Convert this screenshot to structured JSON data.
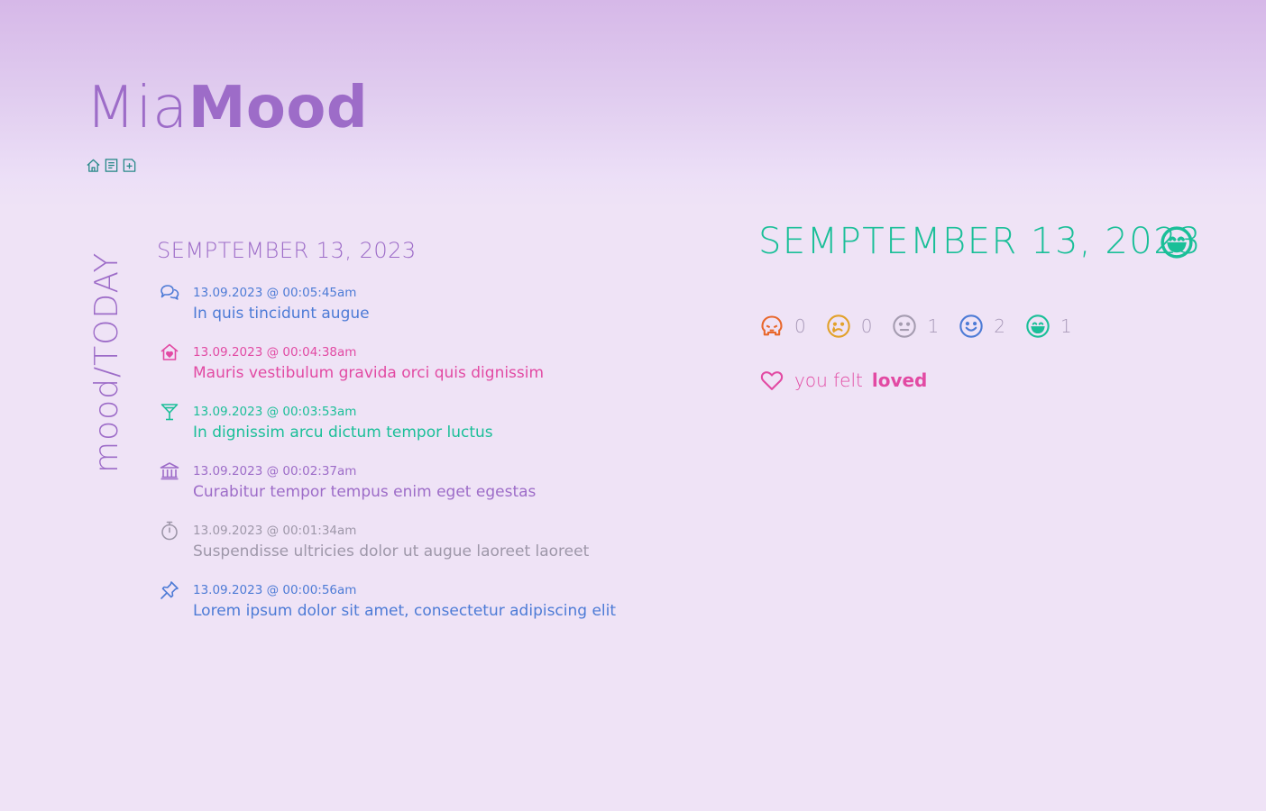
{
  "app": {
    "name_part1": "Mia",
    "name_part2": "Mood"
  },
  "nav": {
    "items": [
      {
        "icon": "home-icon"
      },
      {
        "icon": "document-icon"
      },
      {
        "icon": "add-entry-icon"
      }
    ]
  },
  "section_label": "mood/TODAY",
  "day_title": "SEMPTEMBER 13, 2023",
  "entries": [
    {
      "icon": "chat-bubbles-icon",
      "color": "#4d7bd6",
      "timestamp": "13.09.2023 @ 00:05:45am",
      "text": "In quis tincidunt augue"
    },
    {
      "icon": "home-heart-icon",
      "color": "#e24aa3",
      "timestamp": "13.09.2023 @ 00:04:38am",
      "text": "Mauris vestibulum gravida orci quis dignissim"
    },
    {
      "icon": "cocktail-glass-icon",
      "color": "#1abf98",
      "timestamp": "13.09.2023 @ 00:03:53am",
      "text": "In dignissim arcu dictum tempor luctus"
    },
    {
      "icon": "bank-building-icon",
      "color": "#9d6cc8",
      "timestamp": "13.09.2023 @ 00:02:37am",
      "text": "Curabitur tempor tempus enim eget egestas"
    },
    {
      "icon": "stopwatch-icon",
      "color": "#9e97a9",
      "timestamp": "13.09.2023 @ 00:01:34am",
      "text": "Suspendisse ultricies dolor ut augue laoreet laoreet"
    },
    {
      "icon": "pushpin-icon",
      "color": "#4d7bd6",
      "timestamp": "13.09.2023 @ 00:00:56am",
      "text": "Lorem ipsum dolor sit amet, consectetur adipiscing elit"
    }
  ],
  "summary": {
    "date": "SEMPTEMBER 13, 2023",
    "overall_mood_icon": "grin-face-icon",
    "counts": [
      {
        "icon": "angry-face-icon",
        "color": "#e8672b",
        "value": "0"
      },
      {
        "icon": "sad-tear-face-icon",
        "color": "#e2a12a",
        "value": "0"
      },
      {
        "icon": "neutral-face-icon",
        "color": "#a59cb0",
        "value": "1"
      },
      {
        "icon": "smile-face-icon",
        "color": "#4d7bd6",
        "value": "2"
      },
      {
        "icon": "grin-face-icon",
        "color": "#1abf98",
        "value": "1"
      }
    ],
    "felt_prefix": "you felt",
    "felt_word": "loved",
    "felt_icon": "heart-icon"
  },
  "colors": {
    "brand": "#9d6cc8",
    "accent": "#1abf98",
    "pink": "#e24aa3",
    "blue": "#4d7bd6",
    "background": "#efe3f6"
  }
}
